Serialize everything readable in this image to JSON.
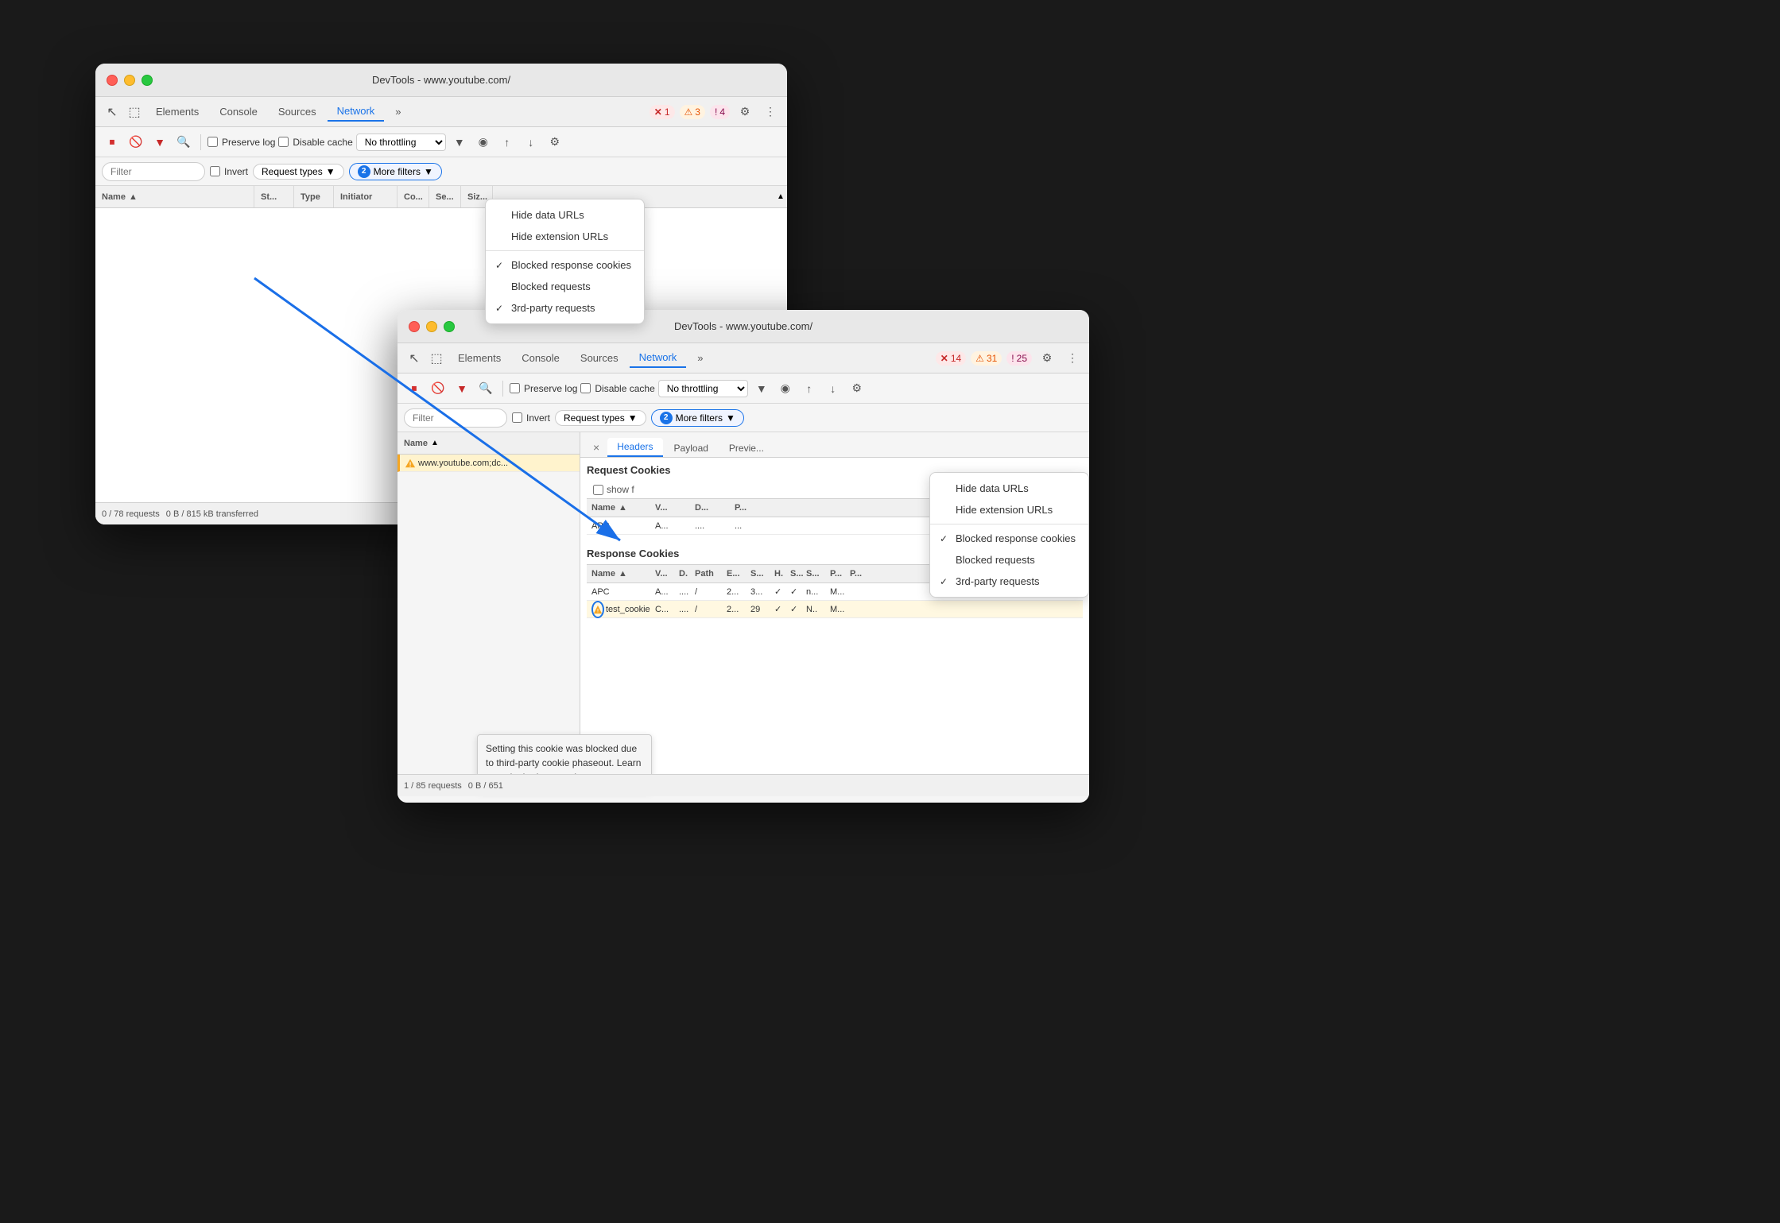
{
  "back_window": {
    "title": "DevTools - www.youtube.com/",
    "tabs": [
      {
        "label": "Elements",
        "active": false
      },
      {
        "label": "Console",
        "active": false
      },
      {
        "label": "Sources",
        "active": false
      },
      {
        "label": "Network",
        "active": true
      },
      {
        "label": "»",
        "active": false
      }
    ],
    "badges": [
      {
        "type": "error",
        "icon": "✕",
        "count": "1"
      },
      {
        "type": "warning",
        "icon": "⚠",
        "count": "3"
      },
      {
        "type": "info",
        "icon": "!",
        "count": "4"
      }
    ],
    "toolbar": {
      "preserve_log_label": "Preserve log",
      "disable_cache_label": "Disable cache",
      "throttle_value": "No throttling"
    },
    "filter": {
      "placeholder": "Filter",
      "invert_label": "Invert",
      "request_types_label": "Request types",
      "more_filters_label": "More filters",
      "more_filters_count": "2"
    },
    "table_headers": [
      "Name",
      "St...",
      "Type",
      "Initiator",
      "Co...",
      "Se...",
      "Siz..."
    ],
    "status_bar": {
      "requests": "0 / 78 requests",
      "transferred": "0 B / 815 kB transferred"
    },
    "dropdown": {
      "items": [
        {
          "label": "Hide data URLs",
          "checked": false
        },
        {
          "label": "Hide extension URLs",
          "checked": false
        },
        {
          "separator": true
        },
        {
          "label": "Blocked response cookies",
          "checked": true
        },
        {
          "label": "Blocked requests",
          "checked": false
        },
        {
          "label": "3rd-party requests",
          "checked": true
        }
      ]
    }
  },
  "front_window": {
    "title": "DevTools - www.youtube.com/",
    "tabs": [
      {
        "label": "Elements",
        "active": false
      },
      {
        "label": "Console",
        "active": false
      },
      {
        "label": "Sources",
        "active": false
      },
      {
        "label": "Network",
        "active": true
      },
      {
        "label": "»",
        "active": false
      }
    ],
    "badges": [
      {
        "type": "error",
        "icon": "✕",
        "count": "14"
      },
      {
        "type": "warning",
        "icon": "⚠",
        "count": "31"
      },
      {
        "type": "info",
        "icon": "!",
        "count": "25"
      }
    ],
    "toolbar": {
      "preserve_log_label": "Preserve log",
      "disable_cache_label": "Disable cache",
      "throttle_value": "No throttling"
    },
    "filter": {
      "placeholder": "Filter",
      "invert_label": "Invert",
      "request_types_label": "Request types",
      "more_filters_label": "More filters",
      "more_filters_count": "2"
    },
    "name_column_header": "Name",
    "request_entry": {
      "warning": true,
      "name": "www.youtube.com;dc..."
    },
    "panel_tabs": [
      "×",
      "Headers",
      "Payload",
      "Previe..."
    ],
    "request_cookies": {
      "title": "Request Cookies",
      "show_filter_label": "show f",
      "headers": [
        "Name",
        "V...",
        "D..."
      ],
      "rows": [
        {
          "name": "APC",
          "v": "A...",
          "d": "...."
        }
      ]
    },
    "response_cookies": {
      "title": "Response Cookies",
      "headers": [
        "Name",
        "V...",
        "D.",
        "Path",
        "E...",
        "S...",
        "H.",
        "S...",
        "S...",
        "P...",
        "P..."
      ],
      "rows": [
        {
          "name": "APC",
          "v": "A...",
          "d": "....",
          "path": "/",
          "e": "2...",
          "s": "3...",
          "h": "✓",
          "s2": "✓",
          "s3": "n...",
          "p": "M..."
        },
        {
          "name": "test_cookie",
          "v": "C...",
          "d": "....",
          "path": "/",
          "e": "2...",
          "s": "29",
          "h": "✓",
          "s2": "✓",
          "s3": "N..",
          "p": "M...",
          "highlighted": true,
          "warning": true
        }
      ]
    },
    "tooltip": "Setting this cookie was blocked due to third-party cookie phaseout. Learn more in the Issues tab.",
    "dropdown": {
      "items": [
        {
          "label": "Hide data URLs",
          "checked": false
        },
        {
          "label": "Hide extension URLs",
          "checked": false
        },
        {
          "separator": true
        },
        {
          "label": "Blocked response cookies",
          "checked": true
        },
        {
          "label": "Blocked requests",
          "checked": false
        },
        {
          "label": "3rd-party requests",
          "checked": true
        }
      ]
    },
    "status_bar": {
      "requests": "1 / 85 requests",
      "transferred": "0 B / 651"
    }
  },
  "icons": {
    "stop": "⏹",
    "clear": "🚫",
    "filter": "▼",
    "search": "🔍",
    "gear": "⚙",
    "more": "⋮",
    "upload": "↑",
    "download": "↓",
    "wifi": "◉",
    "select": "⬚",
    "cursor": "↖",
    "expand": "⊞"
  }
}
